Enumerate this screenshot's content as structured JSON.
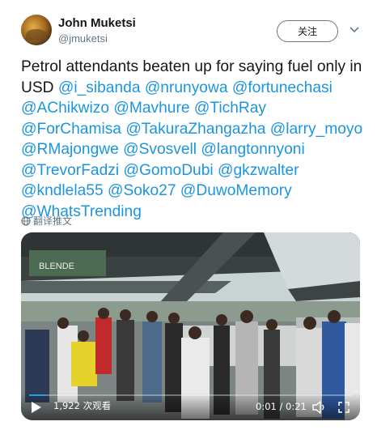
{
  "author": {
    "display_name": "John Muketsi",
    "handle": "@jmuketsi",
    "avatar_icon": "profile-photo"
  },
  "follow_label": "关注",
  "more_icon": "chevron-down-icon",
  "tweet": {
    "text": "Petrol attendants beaten up for saying fuel only in USD",
    "mentions": [
      "@i_sibanda",
      "@nrunyowa",
      "@fortunechasi",
      "@AChikwizo",
      "@Mavhure",
      "@TichRay",
      "@ForChamisa",
      "@TakuraZhangazha",
      "@larry_moyo",
      "@RMajongwe",
      "@Svosvell",
      "@langtonnyoni",
      "@TrevorFadzi",
      "@GomoDubi",
      "@gkzwalter",
      "@kndlela55",
      "@Soko27",
      "@DuwoMemory",
      "@WhatsTrending"
    ]
  },
  "translate_label": "翻译推文",
  "video": {
    "views": "1,922 次观看",
    "time": "0:01 / 0:21",
    "progress_fraction": 0.05,
    "station_sign": "BLENDE",
    "accent_color": "#1da1f2"
  }
}
